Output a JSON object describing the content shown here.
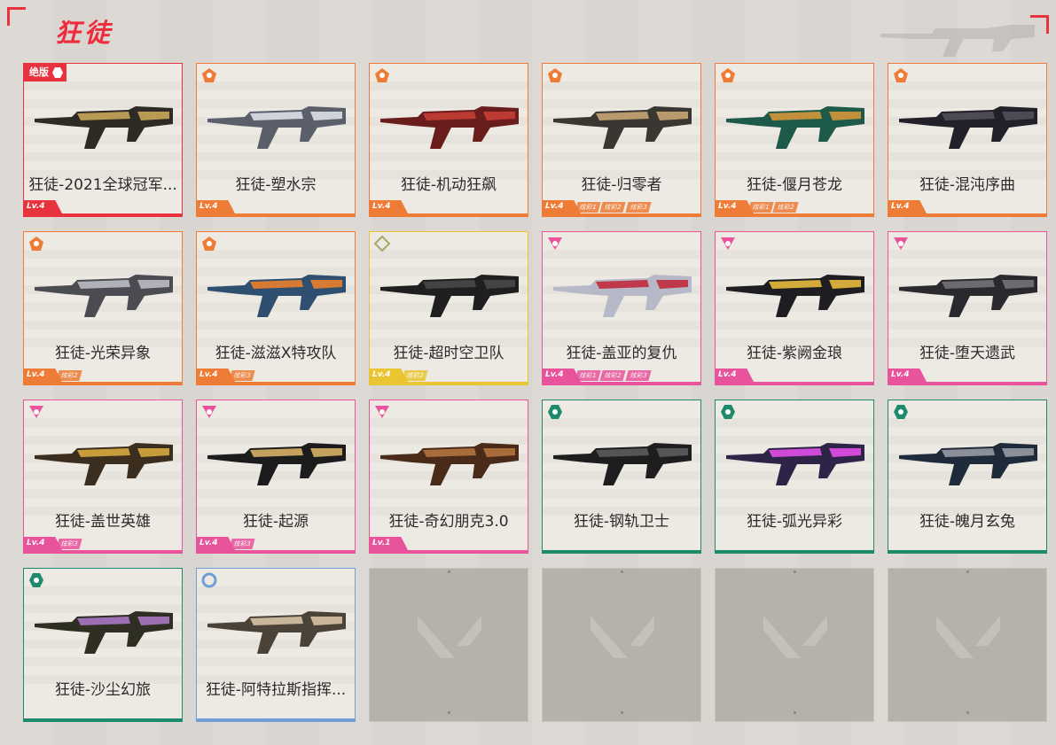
{
  "page": {
    "title": "狂徒"
  },
  "badge_text": "绝版",
  "colors": {
    "red": "#e8333f",
    "orange": "#ef7c36",
    "yellow": "#e9c531",
    "pink": "#e8539b",
    "green": "#1d8a6c",
    "blue": "#6f9fd6"
  },
  "cards": [
    {
      "name": "狂徒-2021全球冠军...",
      "level": "Lv.4",
      "rarity": "red",
      "icon": "pentagon-icon",
      "badge": true,
      "tags": []
    },
    {
      "name": "狂徒-塑水宗",
      "level": "Lv.4",
      "rarity": "orange",
      "icon": "pentagon-icon",
      "tags": []
    },
    {
      "name": "狂徒-机动狂飙",
      "level": "Lv.4",
      "rarity": "orange",
      "icon": "pentagon-icon",
      "tags": []
    },
    {
      "name": "狂徒-归零者",
      "level": "Lv.4",
      "rarity": "orange",
      "icon": "pentagon-icon",
      "tags": [
        "炫彩1",
        "炫彩2",
        "炫彩3"
      ]
    },
    {
      "name": "狂徒-偃月苍龙",
      "level": "Lv.4",
      "rarity": "orange",
      "icon": "pentagon-icon",
      "tags": [
        "炫彩1",
        "炫彩2"
      ]
    },
    {
      "name": "狂徒-混沌序曲",
      "level": "Lv.4",
      "rarity": "orange",
      "icon": "pentagon-icon",
      "tags": []
    },
    {
      "name": "狂徒-光荣异象",
      "level": "Lv.4",
      "rarity": "orange",
      "icon": "pentagon-icon",
      "tags": [
        "炫彩2"
      ]
    },
    {
      "name": "狂徒-滋滋X特攻队",
      "level": "Lv.4",
      "rarity": "orange",
      "icon": "pentagon-icon",
      "tags": [
        "炫彩3"
      ]
    },
    {
      "name": "狂徒-超时空卫队",
      "level": "Lv.4",
      "rarity": "yellow",
      "icon": "diamond-icon",
      "tags": [
        "炫彩2"
      ]
    },
    {
      "name": "狂徒-盖亚的复仇",
      "level": "Lv.4",
      "rarity": "pink",
      "icon": "triangle-icon",
      "tags": [
        "炫彩1",
        "炫彩2",
        "炫彩3"
      ]
    },
    {
      "name": "狂徒-紫阙金琅",
      "level": "Lv.4",
      "rarity": "pink",
      "icon": "triangle-icon",
      "tags": []
    },
    {
      "name": "狂徒-堕天遗武",
      "level": "Lv.4",
      "rarity": "pink",
      "icon": "triangle-icon",
      "tags": []
    },
    {
      "name": "狂徒-盖世英雄",
      "level": "Lv.4",
      "rarity": "pink",
      "icon": "triangle-icon",
      "tags": [
        "炫彩3"
      ]
    },
    {
      "name": "狂徒-起源",
      "level": "Lv.4",
      "rarity": "pink",
      "icon": "triangle-icon",
      "tags": [
        "炫彩3"
      ]
    },
    {
      "name": "狂徒-奇幻朋克3.0",
      "level": "Lv.1",
      "rarity": "pink",
      "icon": "triangle-icon",
      "tags": []
    },
    {
      "name": "狂徒-钢轨卫士",
      "level": "",
      "rarity": "green",
      "icon": "hexagon-icon",
      "tags": []
    },
    {
      "name": "狂徒-弧光异彩",
      "level": "",
      "rarity": "green",
      "icon": "hexagon-icon",
      "tags": []
    },
    {
      "name": "狂徒-魄月玄兔",
      "level": "",
      "rarity": "green",
      "icon": "hexagon-icon",
      "tags": []
    },
    {
      "name": "狂徒-沙尘幻旅",
      "level": "",
      "rarity": "green",
      "icon": "hexagon-icon",
      "tags": []
    },
    {
      "name": "狂徒-阿特拉斯指挥...",
      "level": "",
      "rarity": "blue",
      "icon": "circle-icon",
      "tags": []
    }
  ],
  "empty_slots": 4
}
